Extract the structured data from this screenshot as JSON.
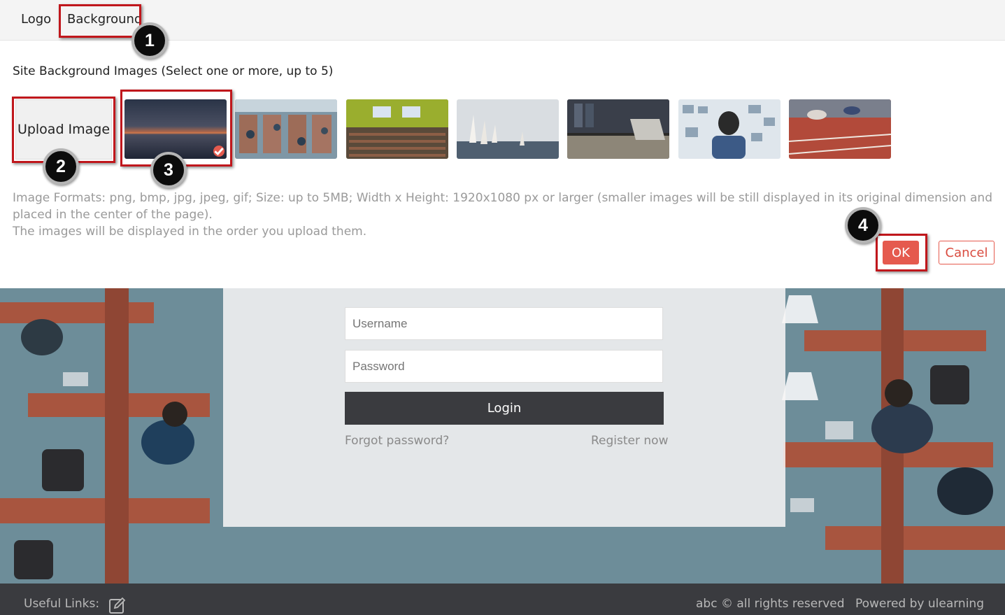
{
  "tabs": {
    "logo_label": "Logo",
    "background_label": "Background"
  },
  "panel": {
    "title": "Site Background Images (Select one or more, up to 5)",
    "upload_label": "Upload Image",
    "thumbnails": [
      {
        "name": "sunset-sea",
        "selected": true
      },
      {
        "name": "library-overhead",
        "selected": false
      },
      {
        "name": "lecture-hall",
        "selected": false
      },
      {
        "name": "sailboats",
        "selected": false
      },
      {
        "name": "desk-laptop",
        "selected": false
      },
      {
        "name": "whiteboard-person",
        "selected": false
      },
      {
        "name": "running-track",
        "selected": false
      }
    ],
    "help_line1": "Image Formats: png, bmp, jpg, jpeg, gif; Size: up to 5MB; Width x Height: 1920x1080 px or larger (smaller images will be still displayed in its original dimension and placed in the center of the page).",
    "help_line2": "The images will be displayed in the order you upload them.",
    "ok_label": "OK",
    "cancel_label": "Cancel"
  },
  "callouts": [
    "1",
    "2",
    "3",
    "4"
  ],
  "login": {
    "username_placeholder": "Username",
    "password_placeholder": "Password",
    "login_label": "Login",
    "forgot_label": "Forgot password?",
    "register_label": "Register now"
  },
  "footer": {
    "useful_links": "Useful Links:",
    "copyright": "abc © all rights reserved",
    "powered_by": "Powered by ulearning"
  },
  "colors": {
    "accent": "#e55a4e",
    "annotation": "#c0171c",
    "footer_bg": "#3a3b3f"
  }
}
